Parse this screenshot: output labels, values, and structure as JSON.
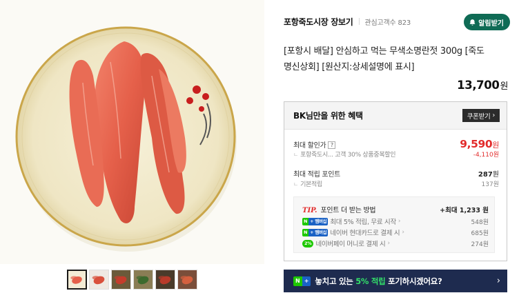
{
  "gallery": {
    "thumbnail_count": 6,
    "active_index": 0
  },
  "store": {
    "name": "포항죽도시장 장보기",
    "followers_label": "관심고객수",
    "followers_count": "823",
    "alarm_button": "알림받기"
  },
  "product": {
    "title": "[포항시 배달] 안심하고 먹는 무색소명란젓 300g [죽도 명신상회] [원산지:상세설명에 표시]",
    "price": "13,700",
    "price_unit": "원"
  },
  "benefit": {
    "title": "BK님만을 위한 혜택",
    "coupon_button": "쿠폰받기",
    "max_discount": {
      "label": "최대 할인가",
      "help": "?",
      "price": "9,590",
      "unit": "원",
      "detail": "포항죽도시... 고객 30% 상품중복할인",
      "detail_value": "-4,110원"
    },
    "max_points": {
      "label": "최대 적립 포인트",
      "value": "287",
      "unit": "원",
      "sub_label": "기본적립",
      "sub_value": "137원"
    },
    "tip": {
      "tip_word": "TIP.",
      "title": "포인트 더 받는 방법",
      "max_text": "+최대 1,233 원",
      "rows": [
        {
          "badge_n": "N",
          "badge_plus": "+",
          "badge_label": "멤버십",
          "text": "최대 5% 적립, 무료 시작",
          "value": "548원"
        },
        {
          "badge_n": "N",
          "badge_plus": "+",
          "badge_label": "멤버십",
          "text": "네이버 현대카드로 결제 시",
          "value": "685원"
        },
        {
          "badge_pct": "2%",
          "text": "네이버페이 머니로 결제 시",
          "value": "274원"
        }
      ]
    }
  },
  "banner": {
    "badge_n": "N",
    "badge_plus": "+",
    "text_before": "놓치고 있는 ",
    "highlight": "5% 적립",
    "text_after": " 포기하시겠어요?"
  },
  "colors": {
    "alarm_green": "#0f6b55",
    "discount_red": "#e22b2b",
    "banner_navy": "#1e2b4f",
    "naver_green": "#1ec800",
    "membership_blue": "#1a62c5"
  }
}
